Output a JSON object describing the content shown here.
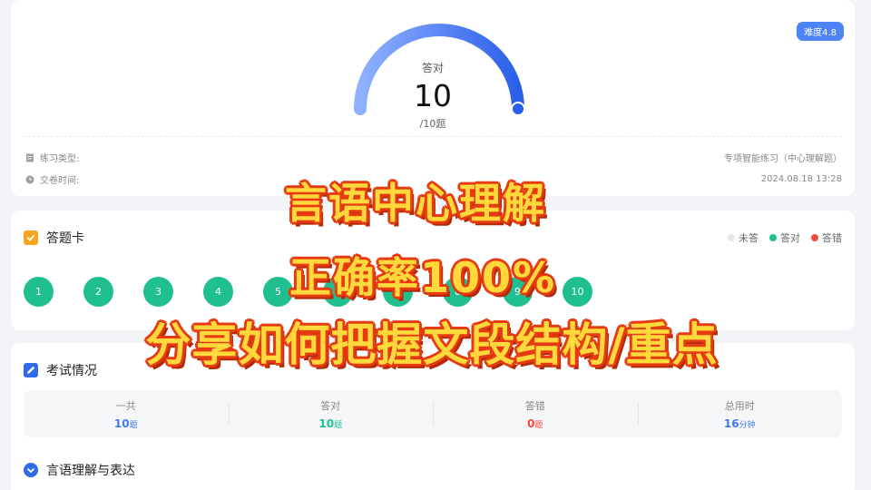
{
  "result": {
    "difficulty": "难度4.8",
    "gauge_label": "答对",
    "correct_count": "10",
    "total": "/10题",
    "correct_fraction": 1.0,
    "practice_type_label": "练习类型:",
    "practice_type_value": "专项智能练习（中心理解题）",
    "submit_time_label": "交卷时间:",
    "submit_time_value": "2024.08.18 13:28"
  },
  "answer_sheet": {
    "title": "答题卡",
    "legend": [
      {
        "label": "未答",
        "color": "#e6e6e6"
      },
      {
        "label": "答对",
        "color": "#1fbf8f"
      },
      {
        "label": "答错",
        "color": "#f0483e"
      }
    ],
    "questions": [
      "1",
      "2",
      "3",
      "4",
      "5",
      "6",
      "7",
      "8",
      "9",
      "10"
    ]
  },
  "exam": {
    "title": "考试情况",
    "stats": [
      {
        "label": "一共",
        "value": "10",
        "unit": "题",
        "color": "#3b7cf0"
      },
      {
        "label": "答对",
        "value": "10",
        "unit": "题",
        "color": "#1fbf8f"
      },
      {
        "label": "答错",
        "value": "0",
        "unit": "题",
        "color": "#f0483e"
      },
      {
        "label": "总用时",
        "value": "16",
        "unit": "分钟",
        "color": "#3b7cf0"
      }
    ],
    "section_title": "言语理解与表达"
  },
  "overlay": {
    "line1": "言语中心理解",
    "line2": "正确率100%",
    "line3": "分享如何把握文段结构/重点"
  },
  "colors": {
    "accent": "#4d83f5",
    "correct": "#1fbf8f",
    "wrong": "#f0483e"
  }
}
